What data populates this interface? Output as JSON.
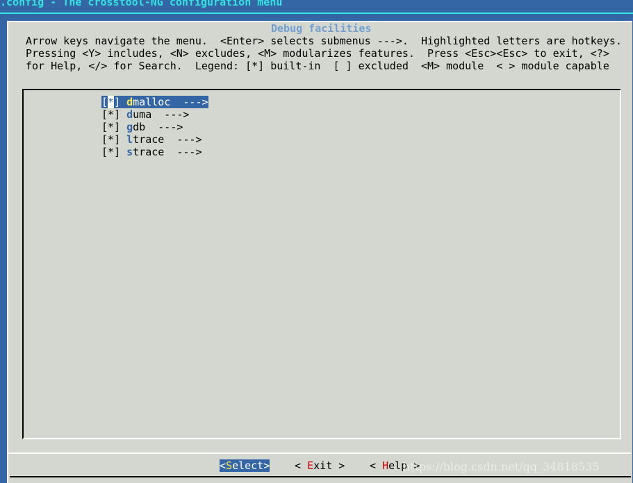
{
  "window": {
    "title": ".config - The crosstool-NG configuration menu"
  },
  "dialog": {
    "title": "Debug facilities",
    "help_lines": [
      "Arrow keys navigate the menu.  <Enter> selects submenus --->.  Highlighted letters are hotkeys.",
      "Pressing <Y> includes, <N> excludes, <M> modularizes features.  Press <Esc><Esc> to exit, <?>",
      "for Help, </> for Search.  Legend: [*] built-in  [ ] excluded  <M> module  < > module capable"
    ]
  },
  "menu": {
    "items": [
      {
        "state_open": "[",
        "state_mark": "*",
        "state_close": "] ",
        "hotkey": "d",
        "rest": "malloc",
        "suffix": "  --->",
        "selected": true
      },
      {
        "state_open": "[",
        "state_mark": "*",
        "state_close": "] ",
        "hotkey": "d",
        "rest": "uma",
        "suffix": "  --->",
        "selected": false
      },
      {
        "state_open": "[",
        "state_mark": "*",
        "state_close": "] ",
        "hotkey": "g",
        "rest": "db",
        "suffix": "  --->",
        "selected": false
      },
      {
        "state_open": "[",
        "state_mark": "*",
        "state_close": "] ",
        "hotkey": "l",
        "rest": "trace",
        "suffix": "  --->",
        "selected": false
      },
      {
        "state_open": "[",
        "state_mark": "*",
        "state_close": "] ",
        "hotkey": "s",
        "rest": "trace",
        "suffix": "  --->",
        "selected": false
      }
    ]
  },
  "buttons": {
    "select": {
      "pre": "<",
      "hotkey": "S",
      "post": "elect>"
    },
    "exit": {
      "pre": "< ",
      "hotkey": "E",
      "post": "xit >"
    },
    "help": {
      "pre": "< ",
      "hotkey": "H",
      "post": "elp >"
    }
  },
  "watermark": "https://blog.csdn.net/qq_34818535",
  "colors": {
    "background": "#3465a4",
    "dialog": "#d3d7cf",
    "title": "#34e2e2",
    "dialog_title": "#729fcf",
    "hotkey": "#3465a4",
    "button_hotkey": "#cc0000",
    "selected_hotkey": "#fce94f"
  }
}
